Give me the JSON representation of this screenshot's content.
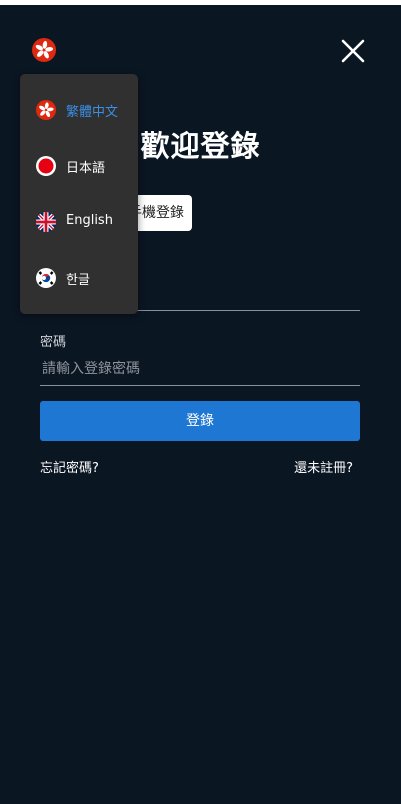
{
  "header": {
    "current_language_icon": "hong-kong-flag-icon",
    "close_icon": "close-icon"
  },
  "main": {
    "title": "歡迎登錄",
    "tab_phone_label": "手機登錄",
    "password_label": "密碼",
    "password_placeholder": "請輸入登錄密碼",
    "password_value": "",
    "login_button": "登錄",
    "forgot_password": "忘記密碼?",
    "register": "還未註冊?"
  },
  "language_menu": {
    "items": [
      {
        "label": "繁體中文",
        "icon": "hong-kong-flag-icon",
        "active": true
      },
      {
        "label": "日本語",
        "icon": "japan-flag-icon",
        "active": false
      },
      {
        "label": "English",
        "icon": "uk-flag-icon",
        "active": false
      },
      {
        "label": "한글",
        "icon": "korea-flag-icon",
        "active": false
      }
    ]
  },
  "colors": {
    "background": "#0b1623",
    "primary": "#1f77d4",
    "menu_background": "#303030",
    "active_language": "#3a8ee6"
  }
}
